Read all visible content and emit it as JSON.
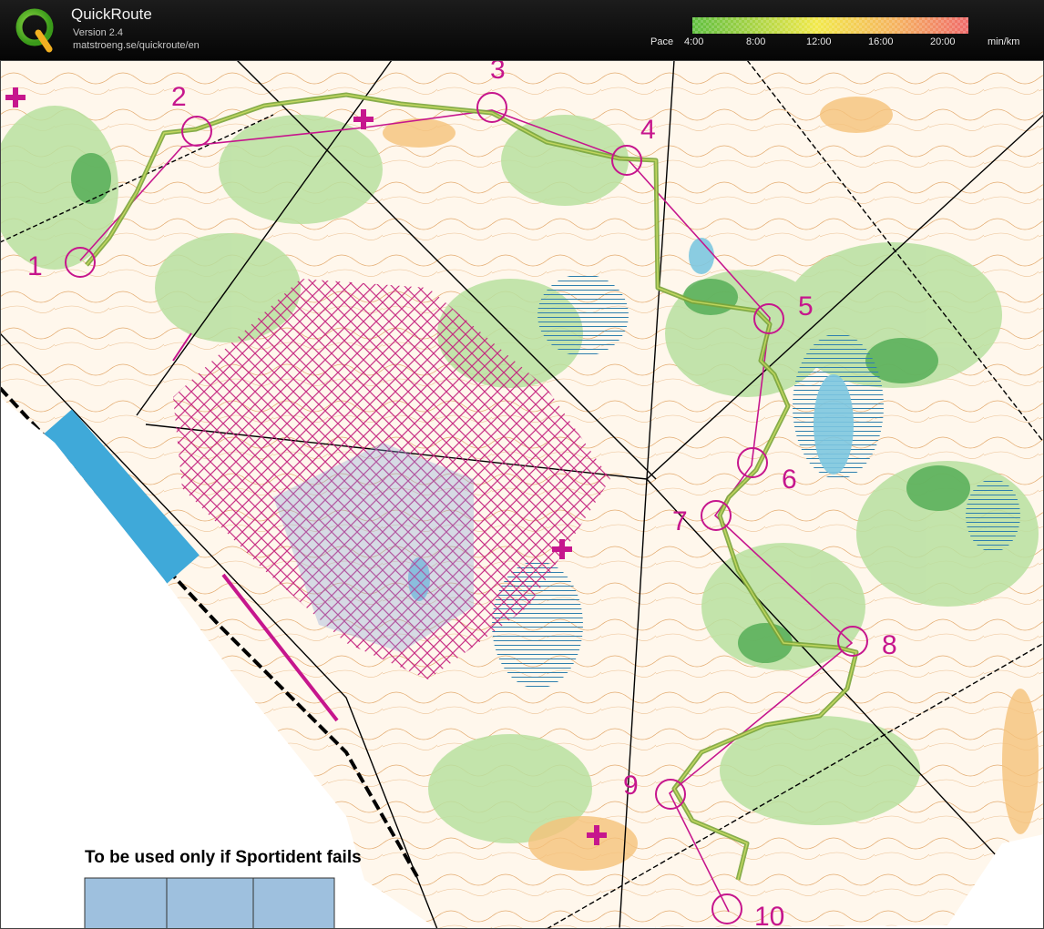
{
  "app": {
    "title": "QuickRoute",
    "version": "Version 2.4",
    "url": "matstroeng.se/quickroute/en"
  },
  "pace_legend": {
    "label": "Pace",
    "ticks": [
      "4:00",
      "8:00",
      "12:00",
      "16:00",
      "20:00"
    ],
    "unit": "min/km",
    "colors": {
      "fast": "#5fbf3f",
      "mid": "#f2e94a",
      "slow": "#f06a6a"
    }
  },
  "map": {
    "controls": [
      "1",
      "2",
      "3",
      "4",
      "5",
      "6",
      "7",
      "8",
      "9",
      "10"
    ],
    "note": "To be used only if Sportident fails",
    "colors": {
      "course": "#c6168d",
      "route": "#6b8e23",
      "water": "#3fa9d9",
      "forbidden": "#c21b7a"
    }
  }
}
